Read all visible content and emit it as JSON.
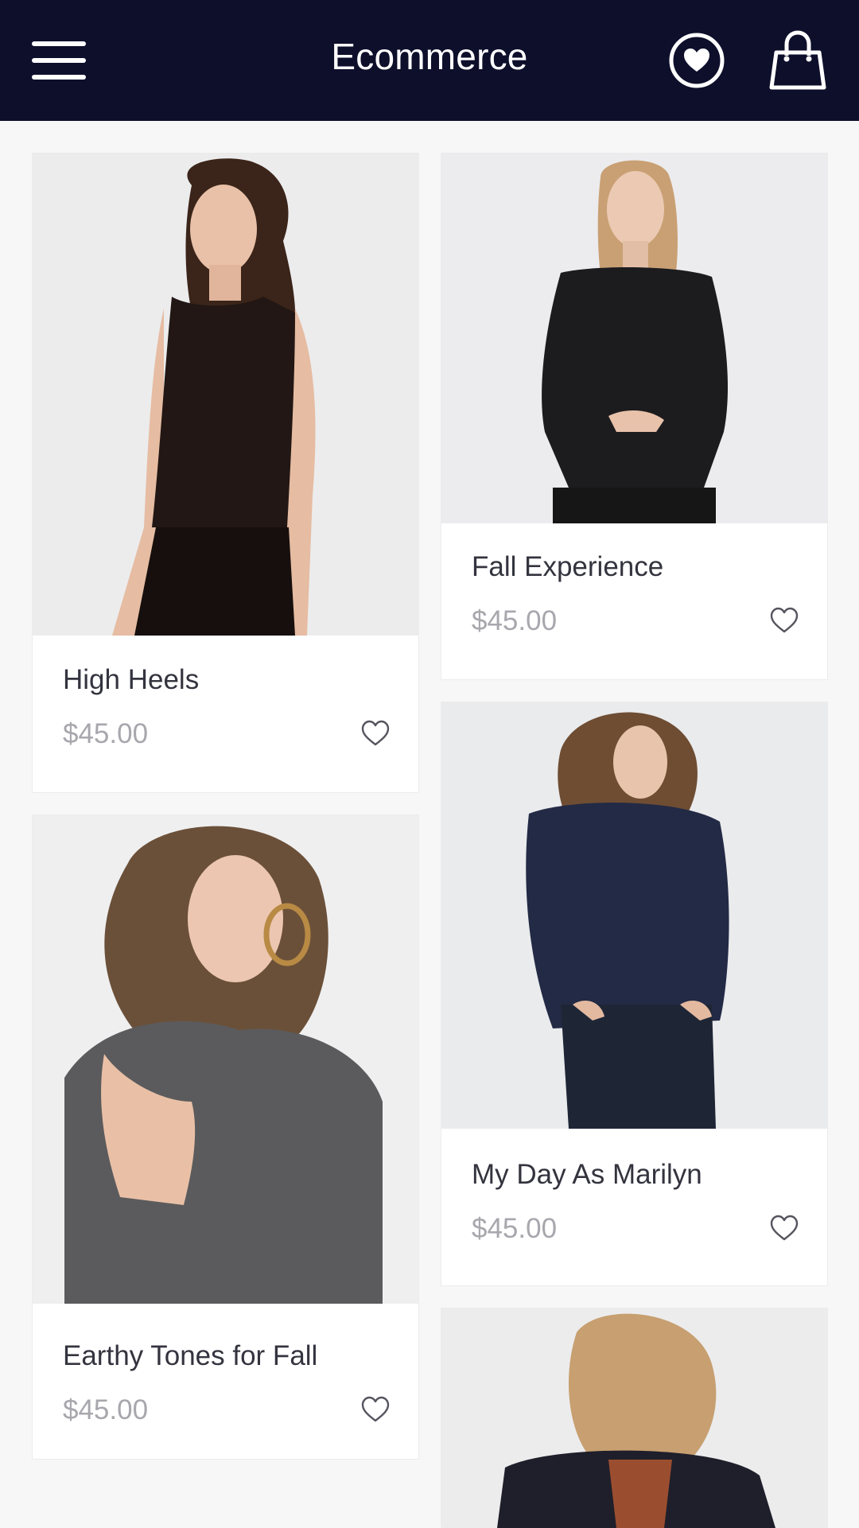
{
  "header": {
    "title": "Ecommerce",
    "menu_icon": "hamburger-menu-icon",
    "wishlist_icon": "heart-circle-icon",
    "cart_icon": "shopping-bag-icon",
    "background": "#0d0f2b"
  },
  "products": [
    {
      "name": "High Heels",
      "price": "$45.00",
      "image": "woman in black sleeveless top"
    },
    {
      "name": "Fall Experience",
      "price": "$45.00",
      "image": "woman in black blouse"
    },
    {
      "name": "Earthy Tones for Fall",
      "price": "$45.00",
      "image": "woman in grey sweater with hoop earring"
    },
    {
      "name": "My Day As Marilyn",
      "price": "$45.00",
      "image": "woman in navy shirt and jeans"
    },
    {
      "name": "",
      "price": "",
      "image": "woman with wavy blonde hair in dark coat"
    }
  ],
  "colors": {
    "accent": "#0d0f2b",
    "title_text": "#34343f",
    "price_text": "#a7a7ad"
  }
}
